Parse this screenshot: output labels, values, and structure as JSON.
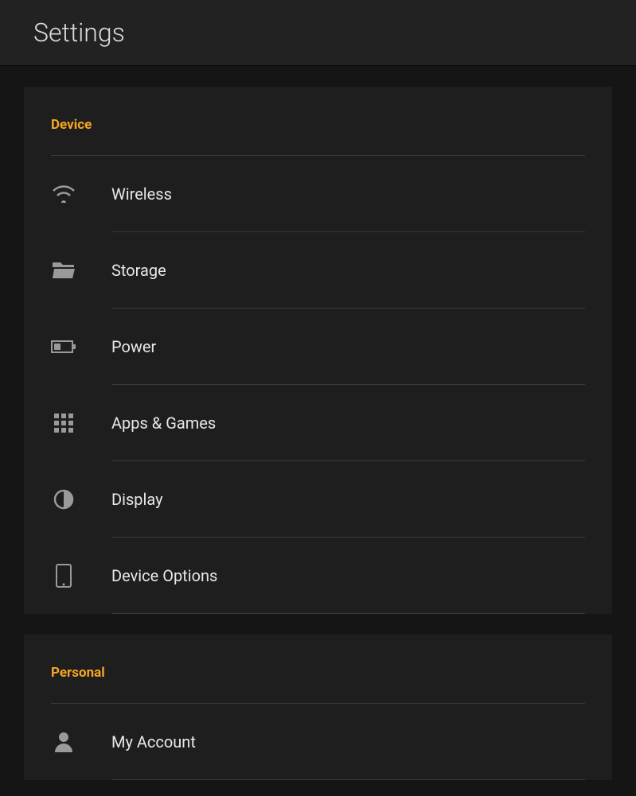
{
  "header": {
    "title": "Settings"
  },
  "sections": {
    "device": {
      "label": "Device",
      "items": {
        "wireless": "Wireless",
        "storage": "Storage",
        "power": "Power",
        "apps_games": "Apps & Games",
        "display": "Display",
        "device_options": "Device Options"
      }
    },
    "personal": {
      "label": "Personal",
      "items": {
        "my_account": "My Account"
      }
    }
  }
}
